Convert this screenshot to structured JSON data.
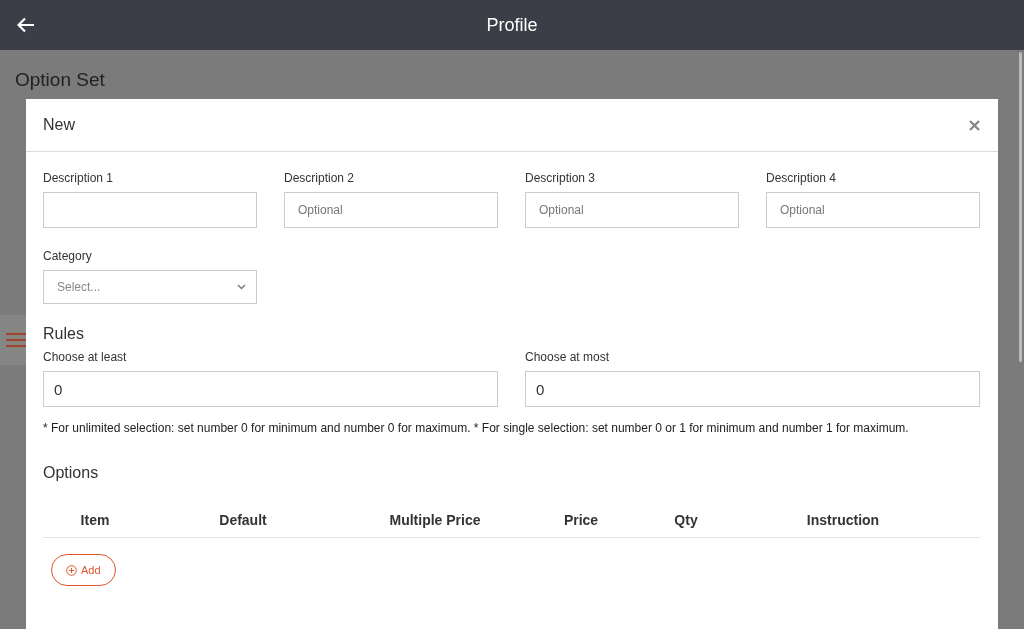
{
  "app_bar": {
    "title": "Profile"
  },
  "page": {
    "title": "Option Set"
  },
  "modal": {
    "title": "New",
    "descriptions": [
      {
        "label": "Description 1"
      },
      {
        "label": "Description 2",
        "placeholder": "Optional"
      },
      {
        "label": "Description 3",
        "placeholder": "Optional"
      },
      {
        "label": "Description 4",
        "placeholder": "Optional"
      }
    ],
    "category": {
      "label": "Category",
      "placeholder": "Select..."
    },
    "rules": {
      "title": "Rules",
      "min": {
        "label": "Choose at least",
        "value": "0"
      },
      "max": {
        "label": "Choose at most",
        "value": "0"
      },
      "note": "* For unlimited selection: set number 0 for minimum and number 0 for maximum. * For single selection: set number 0 or 1 for minimum and number 1 for maximum."
    },
    "options": {
      "title": "Options",
      "columns": [
        "Item",
        "Default",
        "Multiple Price",
        "Price",
        "Qty",
        "Instruction"
      ],
      "add_button": "Add"
    }
  }
}
